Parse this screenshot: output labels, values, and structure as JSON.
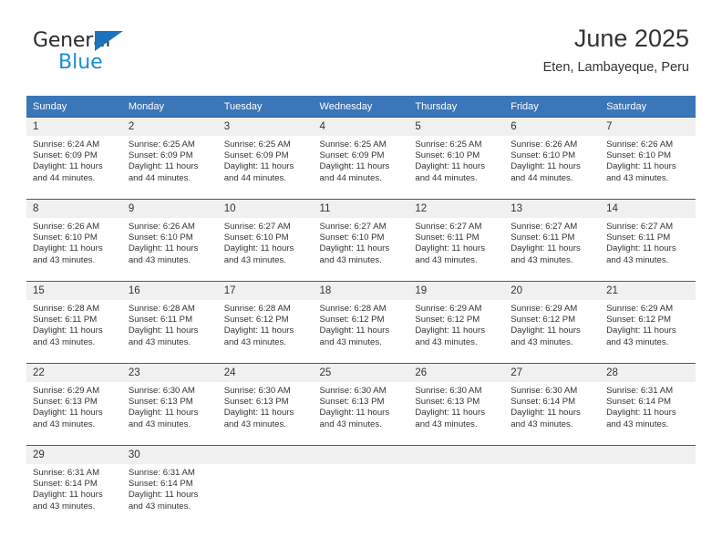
{
  "brand": {
    "name_top": "General",
    "name_bottom": "Blue",
    "logo_icon": "blue-triangle-icon",
    "accent_color": "#1b74bb",
    "secondary_color": "#1b8fd6"
  },
  "header": {
    "title": "June 2025",
    "subtitle": "Eten, Lambayeque, Peru"
  },
  "calendar": {
    "header_bg": "#3a76b8",
    "header_text_color": "#ffffff",
    "daynum_bg": "#f0f0f0",
    "weekdays": [
      "Sunday",
      "Monday",
      "Tuesday",
      "Wednesday",
      "Thursday",
      "Friday",
      "Saturday"
    ],
    "weeks": [
      [
        {
          "day": "1",
          "sunrise": "Sunrise: 6:24 AM",
          "sunset": "Sunset: 6:09 PM",
          "daylight_line1": "Daylight: 11 hours",
          "daylight_line2": "and 44 minutes."
        },
        {
          "day": "2",
          "sunrise": "Sunrise: 6:25 AM",
          "sunset": "Sunset: 6:09 PM",
          "daylight_line1": "Daylight: 11 hours",
          "daylight_line2": "and 44 minutes."
        },
        {
          "day": "3",
          "sunrise": "Sunrise: 6:25 AM",
          "sunset": "Sunset: 6:09 PM",
          "daylight_line1": "Daylight: 11 hours",
          "daylight_line2": "and 44 minutes."
        },
        {
          "day": "4",
          "sunrise": "Sunrise: 6:25 AM",
          "sunset": "Sunset: 6:09 PM",
          "daylight_line1": "Daylight: 11 hours",
          "daylight_line2": "and 44 minutes."
        },
        {
          "day": "5",
          "sunrise": "Sunrise: 6:25 AM",
          "sunset": "Sunset: 6:10 PM",
          "daylight_line1": "Daylight: 11 hours",
          "daylight_line2": "and 44 minutes."
        },
        {
          "day": "6",
          "sunrise": "Sunrise: 6:26 AM",
          "sunset": "Sunset: 6:10 PM",
          "daylight_line1": "Daylight: 11 hours",
          "daylight_line2": "and 44 minutes."
        },
        {
          "day": "7",
          "sunrise": "Sunrise: 6:26 AM",
          "sunset": "Sunset: 6:10 PM",
          "daylight_line1": "Daylight: 11 hours",
          "daylight_line2": "and 43 minutes."
        }
      ],
      [
        {
          "day": "8",
          "sunrise": "Sunrise: 6:26 AM",
          "sunset": "Sunset: 6:10 PM",
          "daylight_line1": "Daylight: 11 hours",
          "daylight_line2": "and 43 minutes."
        },
        {
          "day": "9",
          "sunrise": "Sunrise: 6:26 AM",
          "sunset": "Sunset: 6:10 PM",
          "daylight_line1": "Daylight: 11 hours",
          "daylight_line2": "and 43 minutes."
        },
        {
          "day": "10",
          "sunrise": "Sunrise: 6:27 AM",
          "sunset": "Sunset: 6:10 PM",
          "daylight_line1": "Daylight: 11 hours",
          "daylight_line2": "and 43 minutes."
        },
        {
          "day": "11",
          "sunrise": "Sunrise: 6:27 AM",
          "sunset": "Sunset: 6:10 PM",
          "daylight_line1": "Daylight: 11 hours",
          "daylight_line2": "and 43 minutes."
        },
        {
          "day": "12",
          "sunrise": "Sunrise: 6:27 AM",
          "sunset": "Sunset: 6:11 PM",
          "daylight_line1": "Daylight: 11 hours",
          "daylight_line2": "and 43 minutes."
        },
        {
          "day": "13",
          "sunrise": "Sunrise: 6:27 AM",
          "sunset": "Sunset: 6:11 PM",
          "daylight_line1": "Daylight: 11 hours",
          "daylight_line2": "and 43 minutes."
        },
        {
          "day": "14",
          "sunrise": "Sunrise: 6:27 AM",
          "sunset": "Sunset: 6:11 PM",
          "daylight_line1": "Daylight: 11 hours",
          "daylight_line2": "and 43 minutes."
        }
      ],
      [
        {
          "day": "15",
          "sunrise": "Sunrise: 6:28 AM",
          "sunset": "Sunset: 6:11 PM",
          "daylight_line1": "Daylight: 11 hours",
          "daylight_line2": "and 43 minutes."
        },
        {
          "day": "16",
          "sunrise": "Sunrise: 6:28 AM",
          "sunset": "Sunset: 6:11 PM",
          "daylight_line1": "Daylight: 11 hours",
          "daylight_line2": "and 43 minutes."
        },
        {
          "day": "17",
          "sunrise": "Sunrise: 6:28 AM",
          "sunset": "Sunset: 6:12 PM",
          "daylight_line1": "Daylight: 11 hours",
          "daylight_line2": "and 43 minutes."
        },
        {
          "day": "18",
          "sunrise": "Sunrise: 6:28 AM",
          "sunset": "Sunset: 6:12 PM",
          "daylight_line1": "Daylight: 11 hours",
          "daylight_line2": "and 43 minutes."
        },
        {
          "day": "19",
          "sunrise": "Sunrise: 6:29 AM",
          "sunset": "Sunset: 6:12 PM",
          "daylight_line1": "Daylight: 11 hours",
          "daylight_line2": "and 43 minutes."
        },
        {
          "day": "20",
          "sunrise": "Sunrise: 6:29 AM",
          "sunset": "Sunset: 6:12 PM",
          "daylight_line1": "Daylight: 11 hours",
          "daylight_line2": "and 43 minutes."
        },
        {
          "day": "21",
          "sunrise": "Sunrise: 6:29 AM",
          "sunset": "Sunset: 6:12 PM",
          "daylight_line1": "Daylight: 11 hours",
          "daylight_line2": "and 43 minutes."
        }
      ],
      [
        {
          "day": "22",
          "sunrise": "Sunrise: 6:29 AM",
          "sunset": "Sunset: 6:13 PM",
          "daylight_line1": "Daylight: 11 hours",
          "daylight_line2": "and 43 minutes."
        },
        {
          "day": "23",
          "sunrise": "Sunrise: 6:30 AM",
          "sunset": "Sunset: 6:13 PM",
          "daylight_line1": "Daylight: 11 hours",
          "daylight_line2": "and 43 minutes."
        },
        {
          "day": "24",
          "sunrise": "Sunrise: 6:30 AM",
          "sunset": "Sunset: 6:13 PM",
          "daylight_line1": "Daylight: 11 hours",
          "daylight_line2": "and 43 minutes."
        },
        {
          "day": "25",
          "sunrise": "Sunrise: 6:30 AM",
          "sunset": "Sunset: 6:13 PM",
          "daylight_line1": "Daylight: 11 hours",
          "daylight_line2": "and 43 minutes."
        },
        {
          "day": "26",
          "sunrise": "Sunrise: 6:30 AM",
          "sunset": "Sunset: 6:13 PM",
          "daylight_line1": "Daylight: 11 hours",
          "daylight_line2": "and 43 minutes."
        },
        {
          "day": "27",
          "sunrise": "Sunrise: 6:30 AM",
          "sunset": "Sunset: 6:14 PM",
          "daylight_line1": "Daylight: 11 hours",
          "daylight_line2": "and 43 minutes."
        },
        {
          "day": "28",
          "sunrise": "Sunrise: 6:31 AM",
          "sunset": "Sunset: 6:14 PM",
          "daylight_line1": "Daylight: 11 hours",
          "daylight_line2": "and 43 minutes."
        }
      ],
      [
        {
          "day": "29",
          "sunrise": "Sunrise: 6:31 AM",
          "sunset": "Sunset: 6:14 PM",
          "daylight_line1": "Daylight: 11 hours",
          "daylight_line2": "and 43 minutes."
        },
        {
          "day": "30",
          "sunrise": "Sunrise: 6:31 AM",
          "sunset": "Sunset: 6:14 PM",
          "daylight_line1": "Daylight: 11 hours",
          "daylight_line2": "and 43 minutes."
        },
        {
          "day": "",
          "sunrise": "",
          "sunset": "",
          "daylight_line1": "",
          "daylight_line2": ""
        },
        {
          "day": "",
          "sunrise": "",
          "sunset": "",
          "daylight_line1": "",
          "daylight_line2": ""
        },
        {
          "day": "",
          "sunrise": "",
          "sunset": "",
          "daylight_line1": "",
          "daylight_line2": ""
        },
        {
          "day": "",
          "sunrise": "",
          "sunset": "",
          "daylight_line1": "",
          "daylight_line2": ""
        },
        {
          "day": "",
          "sunrise": "",
          "sunset": "",
          "daylight_line1": "",
          "daylight_line2": ""
        }
      ]
    ]
  }
}
